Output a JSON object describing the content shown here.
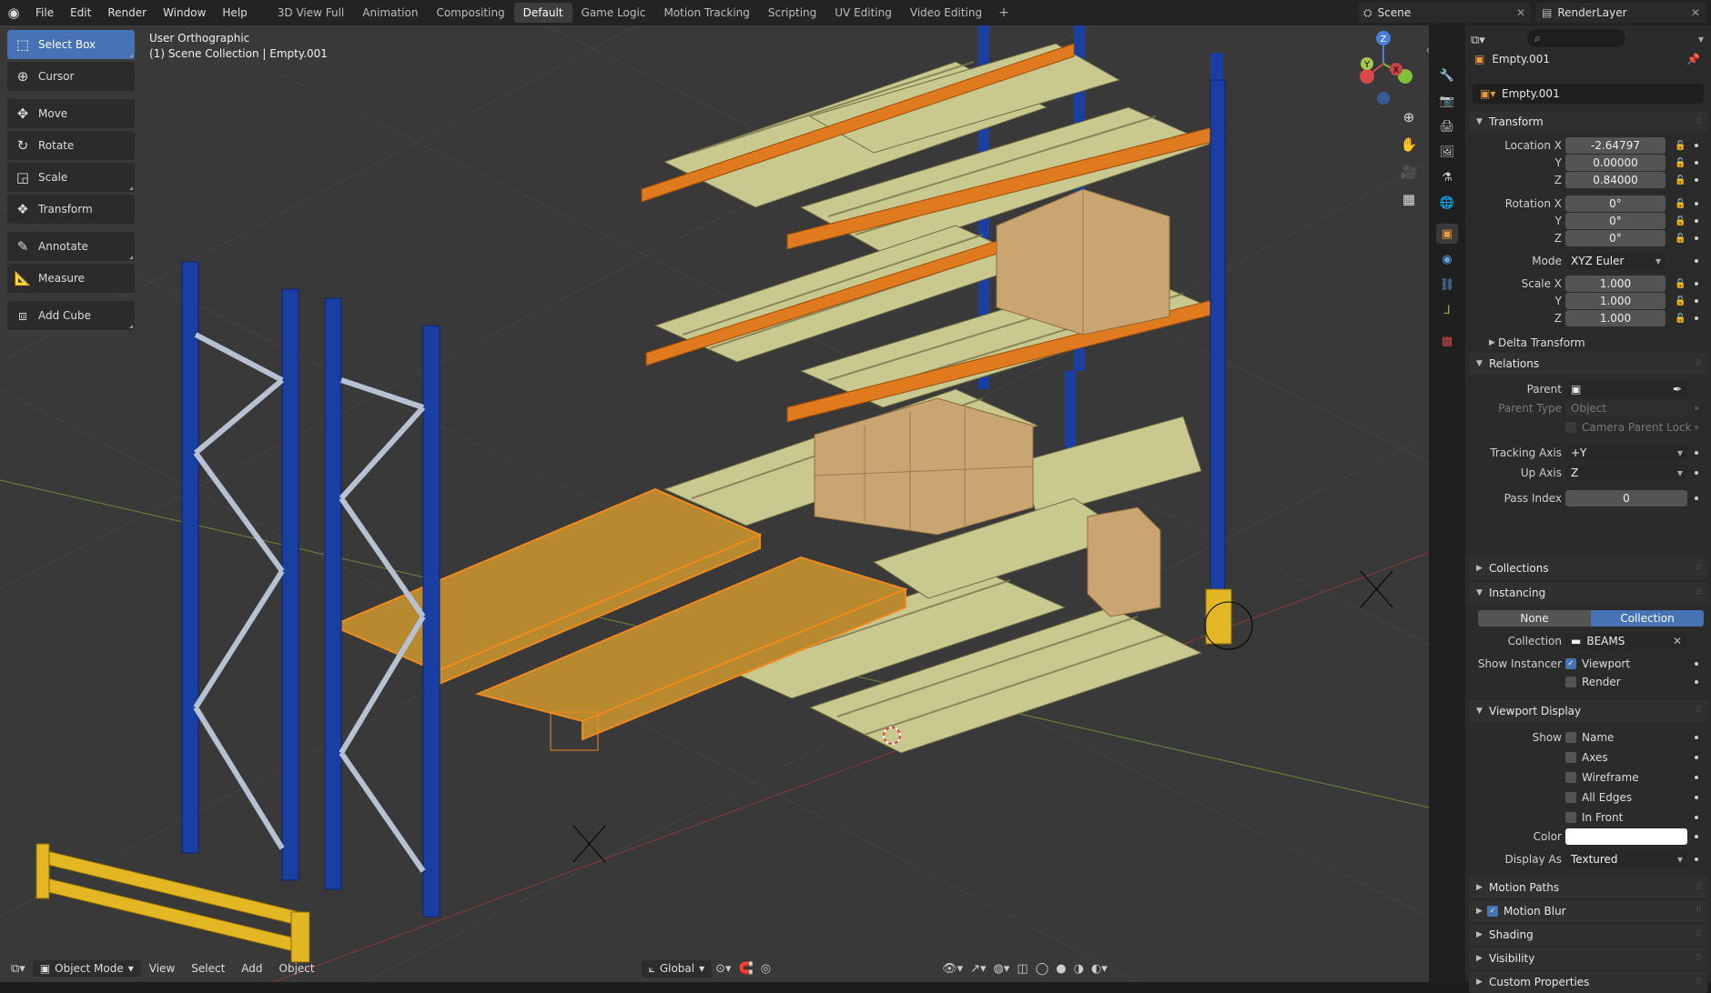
{
  "topbar": {
    "menus": [
      "File",
      "Edit",
      "Render",
      "Window",
      "Help"
    ],
    "workspaces": [
      "3D View Full",
      "Animation",
      "Compositing",
      "Default",
      "Game Logic",
      "Motion Tracking",
      "Scripting",
      "UV Editing",
      "Video Editing"
    ],
    "active_workspace": "Default",
    "add_workspace": "+",
    "scene": "Scene",
    "view_layer": "RenderLayer"
  },
  "toolbar": {
    "tools": [
      {
        "label": "Select Box",
        "icon": "select-box-icon",
        "active": true
      },
      {
        "label": "Cursor",
        "icon": "cursor-icon"
      },
      {
        "label": "Move",
        "icon": "move-icon"
      },
      {
        "label": "Rotate",
        "icon": "rotate-icon"
      },
      {
        "label": "Scale",
        "icon": "scale-icon"
      },
      {
        "label": "Transform",
        "icon": "transform-icon"
      },
      {
        "label": "Annotate",
        "icon": "annotate-icon"
      },
      {
        "label": "Measure",
        "icon": "measure-icon"
      },
      {
        "label": "Add Cube",
        "icon": "add-cube-icon"
      }
    ]
  },
  "viewport": {
    "view_name": "User Orthographic",
    "collection_info": "(1) Scene Collection | Empty.001",
    "gizmo": {
      "x": "X",
      "y": "Y",
      "z": "Z"
    },
    "header": {
      "mode": "Object Mode",
      "menus": [
        "View",
        "Select",
        "Add",
        "Object"
      ],
      "orientation": "Global"
    }
  },
  "properties": {
    "object_name": "Empty.001",
    "data_name": "Empty.001",
    "transform": {
      "title": "Transform",
      "location_label": "Location X",
      "location": [
        "-2.64797",
        "0.00000",
        "0.84000"
      ],
      "rotation_label": "Rotation X",
      "rotation": [
        "0°",
        "0°",
        "0°"
      ],
      "mode_label": "Mode",
      "mode": "XYZ Euler",
      "scale_label": "Scale X",
      "scale": [
        "1.000",
        "1.000",
        "1.000"
      ],
      "axis_y": "Y",
      "axis_z": "Z",
      "delta": "Delta Transform"
    },
    "relations": {
      "title": "Relations",
      "parent_label": "Parent",
      "parent_type_label": "Parent Type",
      "parent_type": "Object",
      "camera_lock": "Camera Parent Lock",
      "tracking_axis_label": "Tracking Axis",
      "tracking_axis": "+Y",
      "up_axis_label": "Up Axis",
      "up_axis": "Z",
      "pass_index_label": "Pass Index",
      "pass_index": "0"
    },
    "collections_title": "Collections",
    "instancing": {
      "title": "Instancing",
      "options": [
        "None",
        "Collection"
      ],
      "selected": "Collection",
      "collection_label": "Collection",
      "collection": "BEAMS",
      "show_instancer_label": "Show Instancer",
      "viewport": "Viewport",
      "render": "Render"
    },
    "viewport_display": {
      "title": "Viewport Display",
      "show_label": "Show",
      "show_options": [
        "Name",
        "Axes",
        "Wireframe",
        "All Edges",
        "In Front"
      ],
      "color_label": "Color",
      "color": "#ffffff",
      "display_as_label": "Display As",
      "display_as": "Textured"
    },
    "collapsed": [
      "Motion Paths",
      "Motion Blur",
      "Shading",
      "Visibility",
      "Custom Properties"
    ]
  }
}
